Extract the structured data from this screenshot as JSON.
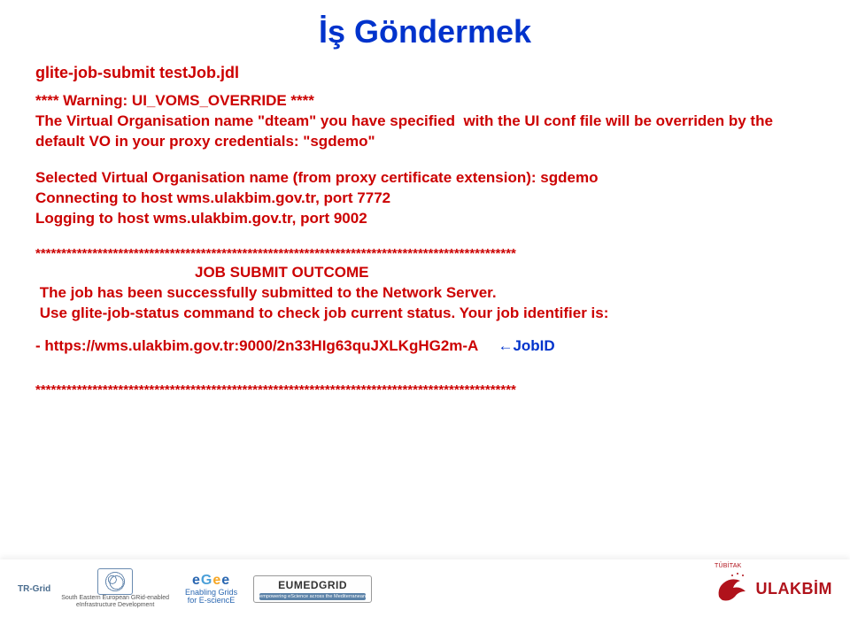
{
  "title": "İş Göndermek",
  "command": "glite-job-submit testJob.jdl",
  "warning_block": "**** Warning: UI_VOMS_OVERRIDE ****\nThe Virtual Organisation name \"dteam\" you have specified  with the UI conf file will be overriden by the\ndefault VO in your proxy credentials: \"sgdemo\"",
  "connect_block": "Selected Virtual Organisation name (from proxy certificate extension): sgdemo\nConnecting to host wms.ulakbim.gov.tr, port 7772\nLogging to host wms.ulakbim.gov.tr, port 9002",
  "separator": "*********************************************************************************************",
  "outcome_label": "JOB SUBMIT OUTCOME",
  "outcome_body": " The job has been successfully submitted to the Network Server.\n Use glite-job-status command to check job current status. Your job identifier is:",
  "jobid_prefix": " - https://wms.ulakbim.gov.tr:9000/2n33HIg63quJXLKgHG2m-A",
  "jobid_annotation": "←JobID",
  "separator2": "*********************************************************************************************",
  "footer": {
    "tr_grid": "TR-Grid",
    "swirl_sub1": "South Eastern European GRid-enabled",
    "swirl_sub2": "eInfrastructure Development",
    "egee": {
      "l1": "e",
      "l2": "G",
      "l3": "e",
      "l4": "e",
      "sub1": "Enabling Grids",
      "sub2": "for E-sciencE"
    },
    "eumed": {
      "name": "EUMEDGRID",
      "tag": "empowering eScience across the Mediterranean"
    },
    "ulakbim": {
      "top": "TÜBİTAK",
      "name": "ULAKBİM"
    }
  }
}
